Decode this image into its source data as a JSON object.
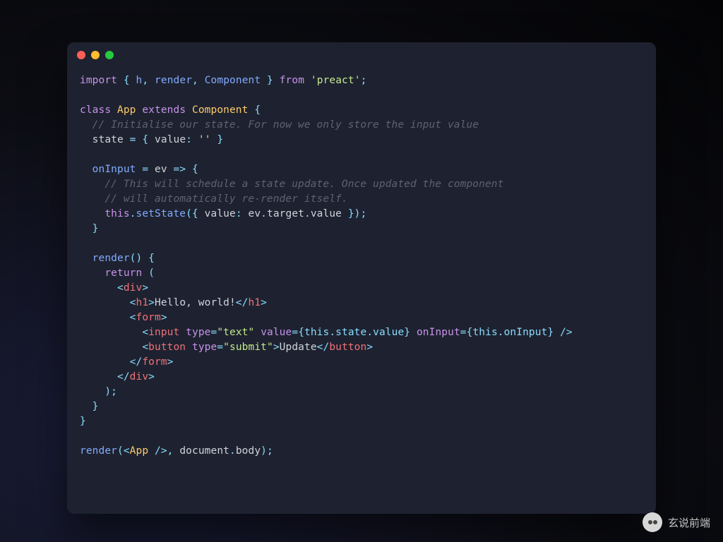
{
  "watermark": {
    "text": "玄说前端"
  },
  "code": {
    "imports": {
      "members": [
        "h",
        "render",
        "Component"
      ],
      "from": "preact"
    },
    "className": "App",
    "extends": "Component",
    "comments": {
      "init": "// Initialise our state. For now we only store the input value",
      "onInput1": "// This will schedule a state update. Once updated the component",
      "onInput2": "// will automatically re-render itself."
    },
    "state": {
      "key": "value",
      "initial": "''"
    },
    "handler": {
      "name": "onInput",
      "param": "ev",
      "body": "this.setState({ value: ev.target.value });"
    },
    "jsx": {
      "heading": "Hello, world!",
      "inputType": "text",
      "inputValueExpr": "{this.state.value}",
      "inputHandlerExpr": "{this.onInput}",
      "buttonType": "submit",
      "buttonLabel": "Update"
    },
    "bootstrap": "render(<App />, document.body);"
  },
  "raw_lines": [
    "import { h, render, Component } from 'preact';",
    "",
    "class App extends Component {",
    "  // Initialise our state. For now we only store the input value",
    "  state = { value: '' }",
    "",
    "  onInput = ev => {",
    "    // This will schedule a state update. Once updated the component",
    "    // will automatically re-render itself.",
    "    this.setState({ value: ev.target.value });",
    "  }",
    "",
    "  render() {",
    "    return (",
    "      <div>",
    "        <h1>Hello, world!</h1>",
    "        <form>",
    "          <input type=\"text\" value={this.state.value} onInput={this.onInput} />",
    "          <button type=\"submit\">Update</button>",
    "        </form>",
    "      </div>",
    "    );",
    "  }",
    "}",
    "",
    "render(<App />, document.body);"
  ]
}
